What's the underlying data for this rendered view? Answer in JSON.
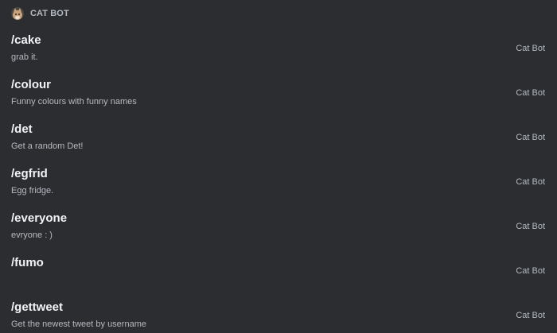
{
  "section": {
    "bot_name": "CAT BOT",
    "avatar_icon": "cat-avatar-icon"
  },
  "commands": [
    {
      "name": "/cake",
      "description": "grab it.",
      "source": "Cat Bot"
    },
    {
      "name": "/colour",
      "description": "Funny colours with funny names",
      "source": "Cat Bot"
    },
    {
      "name": "/det",
      "description": "Get a random Det!",
      "source": "Cat Bot"
    },
    {
      "name": "/egfrid",
      "description": "Egg fridge.",
      "source": "Cat Bot"
    },
    {
      "name": "/everyone",
      "description": "evryone : )",
      "source": "Cat Bot"
    },
    {
      "name": "/fumo",
      "description": "",
      "source": "Cat Bot"
    },
    {
      "name": "/gettweet",
      "description": "Get the newest tweet by username",
      "source": "Cat Bot"
    }
  ],
  "colors": {
    "background": "#2b2d31",
    "command_name": "#f2f3f5",
    "secondary_text": "#b5bac1"
  }
}
